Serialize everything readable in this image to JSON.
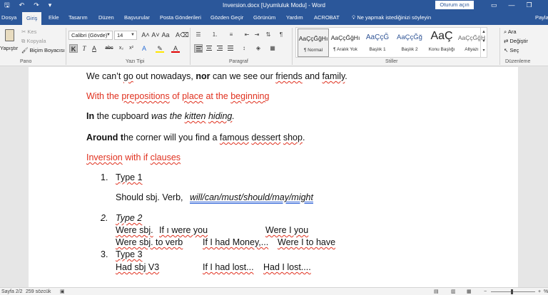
{
  "titlebar": {
    "undo_icon": "undo-icon",
    "redo_icon": "redo-icon",
    "title": "Inversion.docx [Uyumluluk Modu] - Word",
    "signin_label": "Oturum açın"
  },
  "tabs": [
    "Dosya",
    "Giriş",
    "Ekle",
    "Tasarım",
    "Düzen",
    "Başvurular",
    "Posta Gönderileri",
    "Gözden Geçir",
    "Görünüm",
    "Yardım",
    "ACROBAT"
  ],
  "tellme": "Ne yapmak istediğinizi söyleyin",
  "share_label": "Payla",
  "ribbon": {
    "clipboard": {
      "paste": "Yapıştır",
      "cut": "Kes",
      "copy": "Kopyala",
      "format_painter": "Biçim Boyacısı",
      "label": "Pano"
    },
    "font": {
      "name": "Calibri (Gövde)",
      "size": "14",
      "label": "Yazı Tipi"
    },
    "paragraph": {
      "label": "Paragraf"
    },
    "styles": {
      "label": "Stiller",
      "items": [
        {
          "preview": "AaÇçĞğHı",
          "name": "¶ Normal"
        },
        {
          "preview": "AaÇçĞğHı",
          "name": "¶ Aralık Yok"
        },
        {
          "preview": "AaÇçĞ",
          "name": "Başlık 1"
        },
        {
          "preview": "AaÇçĞğ",
          "name": "Başlık 2"
        },
        {
          "preview": "AaÇ",
          "name": "Konu Başlığı"
        },
        {
          "preview": "AaÇçĞğH",
          "name": "Altyazı"
        }
      ]
    },
    "editing": {
      "find": "Ara",
      "replace": "Değiştir",
      "select": "Seç",
      "label": "Düzenleme"
    }
  },
  "document": {
    "line1": {
      "a": "We can’t ",
      "b": "go",
      "c": " out nowadays, ",
      "d": "nor",
      "e": " can we see our ",
      "f": "friends",
      "g": " and ",
      "h": "family",
      "i": "."
    },
    "line2": {
      "a": "With the ",
      "b": "prepositions",
      "c": " of ",
      "d": "place",
      "e": " at the ",
      "f": "beginning"
    },
    "line3": {
      "a": "In",
      "b": " the cupboard ",
      "c": "was the",
      "d": " ",
      "e": "kitten",
      "f": " ",
      "g": "hiding",
      "h": "."
    },
    "line4": {
      "a": "Around",
      "b": " t",
      "c": "he corner will you find a ",
      "d": "famous",
      "e": " ",
      "f": "dessert",
      "g": " ",
      "h": "shop",
      "i": "."
    },
    "line5": {
      "a": "Inversion",
      "b": " with if ",
      "c": "clauses"
    },
    "list": [
      {
        "num": "1.",
        "head": "Type 1"
      },
      {
        "num": "2.",
        "head": "Type 2"
      },
      {
        "num": "3.",
        "head": "Type 3"
      }
    ],
    "type1_line": {
      "a": "Should sbj. Verb,",
      "b": "will/can/must/should/may/might"
    },
    "type2_line1": {
      "a": "Were sbj.",
      "b": "If ı were you",
      "c": "Were I you"
    },
    "type2_line2": {
      "a": "Were sbj. to verb",
      "b": "If I had Money,...",
      "c": "Were I to have"
    },
    "type3_line": {
      "a": "Had sbj V3",
      "b": "If I had lost...",
      "c": "Had I lost...."
    }
  },
  "statusbar": {
    "page": "Sayfa 2/2",
    "words": "259 sözcük",
    "zoom": "%"
  }
}
